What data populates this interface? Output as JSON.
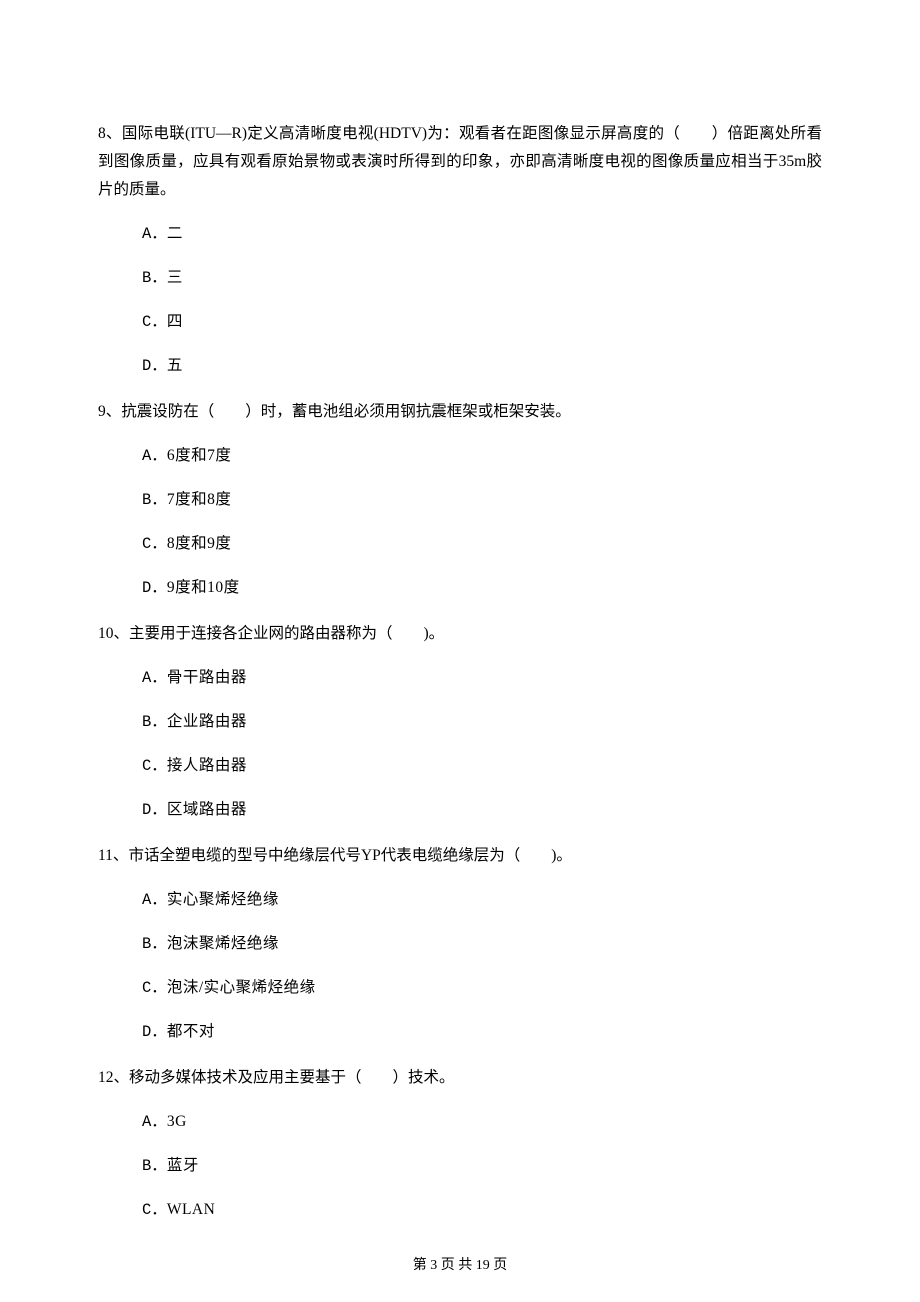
{
  "questions": [
    {
      "number": "8、",
      "text": "国际电联(ITU—R)定义高清晰度电视(HDTV)为：观看者在距图像显示屏高度的（　　）倍距离处所看到图像质量，应具有观看原始景物或表演时所得到的印象，亦即高清晰度电视的图像质量应相当于35m胶片的质量。",
      "options": [
        {
          "label": "A．",
          "text": "二"
        },
        {
          "label": "B．",
          "text": "三"
        },
        {
          "label": "C．",
          "text": "四"
        },
        {
          "label": "D．",
          "text": "五"
        }
      ]
    },
    {
      "number": "9、",
      "text": "抗震设防在（　　）时，蓄电池组必须用钢抗震框架或柜架安装。",
      "options": [
        {
          "label": "A．",
          "text": "6度和7度"
        },
        {
          "label": "B．",
          "text": "7度和8度"
        },
        {
          "label": "C．",
          "text": "8度和9度"
        },
        {
          "label": "D．",
          "text": "9度和10度"
        }
      ]
    },
    {
      "number": "10、",
      "text": "主要用于连接各企业网的路由器称为（　　)。",
      "options": [
        {
          "label": "A．",
          "text": "骨干路由器"
        },
        {
          "label": "B．",
          "text": "企业路由器"
        },
        {
          "label": "C．",
          "text": "接人路由器"
        },
        {
          "label": "D．",
          "text": "区域路由器"
        }
      ]
    },
    {
      "number": "11、",
      "text": "市话全塑电缆的型号中绝缘层代号YP代表电缆绝缘层为（　　)。",
      "options": [
        {
          "label": "A．",
          "text": "实心聚烯烃绝缘"
        },
        {
          "label": "B．",
          "text": "泡沫聚烯烃绝缘"
        },
        {
          "label": "C．",
          "text": "泡沫/实心聚烯烃绝缘"
        },
        {
          "label": "D．",
          "text": "都不对"
        }
      ]
    },
    {
      "number": "12、",
      "text": "移动多媒体技术及应用主要基于（　　）技术。",
      "options": [
        {
          "label": "A．",
          "text": "3G"
        },
        {
          "label": "B．",
          "text": "蓝牙"
        },
        {
          "label": "C．",
          "text": "WLAN"
        }
      ]
    }
  ],
  "footer": "第 3 页 共 19 页"
}
